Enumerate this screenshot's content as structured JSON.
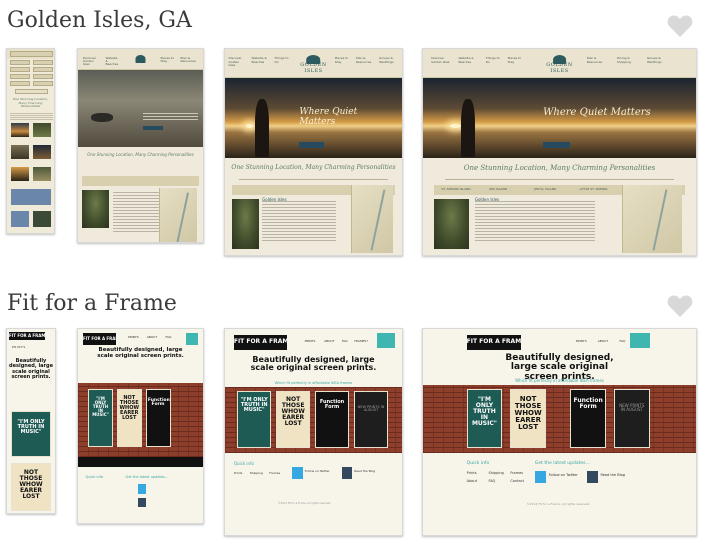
{
  "projects": [
    {
      "title": "Golden Isles, GA",
      "heart_icon": "heart-icon",
      "screens": {
        "nav_items": [
          "Discover Golden Isles",
          "Website & Beaches",
          "Things to Do",
          "Places to Stay",
          "Plan & Resources",
          "Dining & Shopping",
          "Groups & Weddings"
        ],
        "logo": "GOLDEN ISLES",
        "hero_headline": "Where Quiet Matters",
        "hero_cta": "LEARN MORE",
        "tagline": "One Stunning Location, Many Charming Personalities",
        "tabs": [
          "ST. SIMONS ISLAND",
          "SEA ISLAND",
          "JEKYLL ISLAND",
          "LITTLE ST. SIMONS",
          "BRUNSWICK"
        ],
        "feature_title": "Golden Isles"
      }
    },
    {
      "title": "Fit for a Frame",
      "heart_icon": "heart-icon",
      "screens": {
        "logo": "FIT FOR A FRAME",
        "menu": [
          "PRINTS",
          "ABOUT",
          "FAQ",
          "FRAMES?"
        ],
        "headline": "Beautifully designed, large scale original screen prints.",
        "subline": "Which fit perfectly in affordable IKEA frames",
        "posters": [
          "\"I'M ONLY TRUTH IN MUSIC\"",
          "NOT THOSE WHOW EARER LOST",
          "Function Form",
          "NEW PRINTS IN AUGUST"
        ],
        "quick_info": "Quick info",
        "latest_updates": "Get the latest updates...",
        "links": [
          "Prints",
          "About",
          "Shipping",
          "FAQ",
          "Frames",
          "Contact"
        ],
        "follow_twitter": "Follow on Twitter",
        "read_blog": "Read the Blog",
        "copyright": "©2012 Fit for a Frame. All rights reserved."
      }
    }
  ],
  "colors": {
    "heart": "#d8d8d8",
    "title": "#3a3a3a",
    "teal": "#3aa9a3",
    "gi_green": "#5c7b66"
  }
}
